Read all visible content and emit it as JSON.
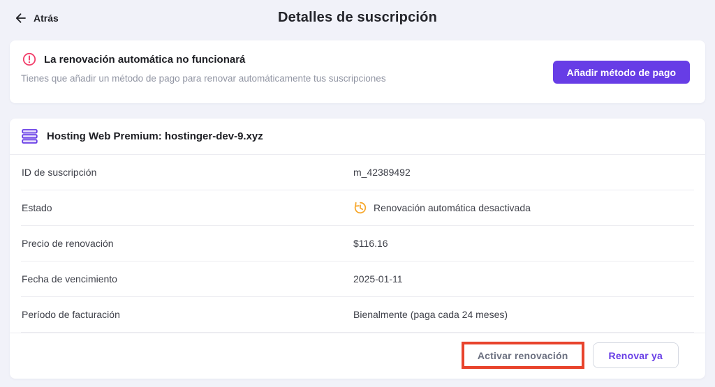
{
  "header": {
    "back_label": "Atrás",
    "title": "Detalles de suscripción"
  },
  "warning": {
    "icon": "alert-circle-icon",
    "title": "La renovación automática no funcionará",
    "subtitle": "Tienes que añadir un método de pago para renovar automáticamente tus suscripciones",
    "button_label": "Añadir método de pago"
  },
  "subscription": {
    "icon": "server-stack-icon",
    "title": "Hosting Web Premium: hostinger-dev-9.xyz",
    "rows": [
      {
        "label": "ID de suscripción",
        "value": "m_42389492"
      },
      {
        "label": "Estado",
        "value": "Renovación automática desactivada",
        "value_icon": "history-clock-icon"
      },
      {
        "label": "Precio de renovación",
        "value": "$116.16"
      },
      {
        "label": "Fecha de vencimiento",
        "value": "2025-01-11"
      },
      {
        "label": "Período de facturación",
        "value": "Bienalmente (paga cada 24 meses)"
      }
    ],
    "actions": {
      "activate_label": "Activar renovación",
      "renew_label": "Renovar ya"
    }
  },
  "colors": {
    "accent_purple": "#673de6",
    "danger_pink": "#f23e6a",
    "warning_amber": "#f7a82d",
    "annotation_highlight_red": "#e8432c",
    "page_background": "#f1f2f9"
  }
}
